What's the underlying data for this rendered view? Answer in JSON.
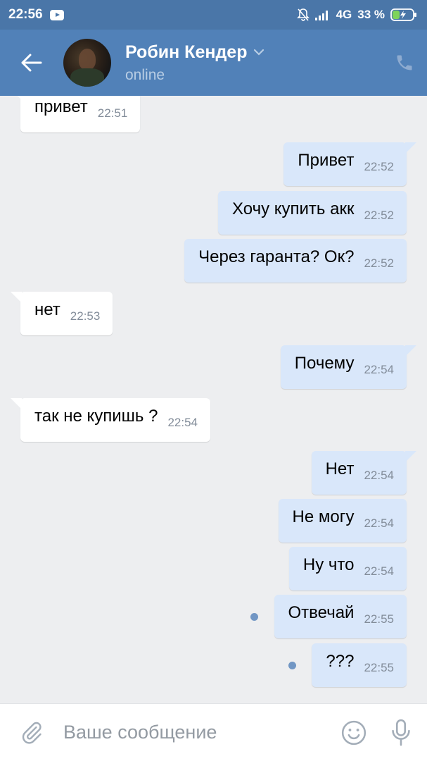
{
  "status_bar": {
    "time": "22:56",
    "network": "4G",
    "battery": "33 %"
  },
  "header": {
    "contact_name": "Робин Кендер",
    "contact_status": "online"
  },
  "messages": [
    {
      "dir": "in",
      "text": "привет",
      "time": "22:51"
    },
    {
      "dir": "out",
      "text": "Привет",
      "time": "22:52"
    },
    {
      "dir": "out",
      "text": "Хочу купить акк",
      "time": "22:52"
    },
    {
      "dir": "out",
      "text": "Через гаранта? Ок?",
      "time": "22:52"
    },
    {
      "dir": "in",
      "text": "нет",
      "time": "22:53"
    },
    {
      "dir": "out",
      "text": "Почему",
      "time": "22:54"
    },
    {
      "dir": "in",
      "text": "так не купишь ?",
      "time": "22:54"
    },
    {
      "dir": "out",
      "text": "Нет",
      "time": "22:54"
    },
    {
      "dir": "out",
      "text": "Не могу",
      "time": "22:54"
    },
    {
      "dir": "out",
      "text": "Ну что",
      "time": "22:54"
    },
    {
      "dir": "out",
      "text": "Отвечай",
      "time": "22:55",
      "unread": true
    },
    {
      "dir": "out",
      "text": "???",
      "time": "22:55",
      "unread": true
    }
  ],
  "composer": {
    "placeholder": "Ваше сообщение"
  },
  "colors": {
    "header_bg": "#5181b8",
    "status_bg": "#4a76a8",
    "incoming_bubble": "#ffffff",
    "outgoing_bubble": "#d9e7fa",
    "unread_dot": "#7196c4"
  },
  "icons": [
    "youtube-icon",
    "bell-off-icon",
    "signal-icon",
    "battery-charging-icon",
    "back-arrow-icon",
    "chevron-down-icon",
    "phone-icon",
    "paperclip-icon",
    "emoji-icon",
    "microphone-icon"
  ]
}
